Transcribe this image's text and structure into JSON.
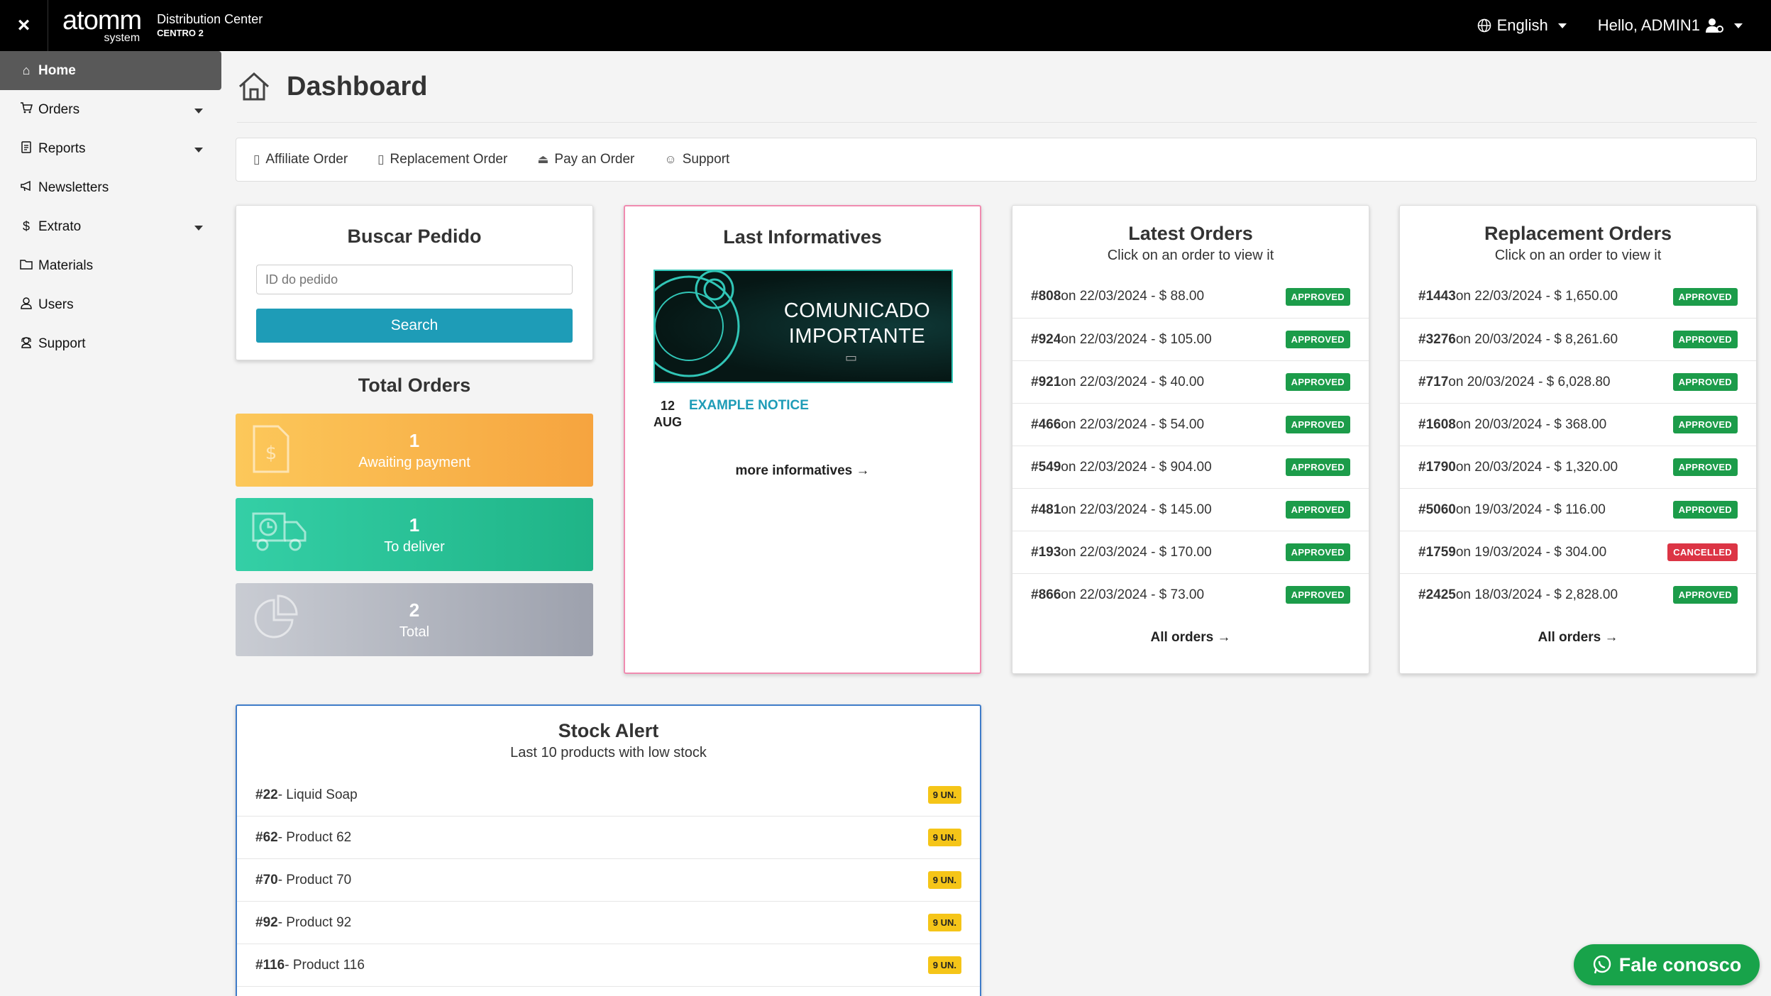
{
  "topbar": {
    "close_label": "×",
    "logo_main": "atomm",
    "logo_sub": "system",
    "center_title": "Distribution Center",
    "center_sub": "CENTRO 2",
    "language": "English",
    "greeting": "Hello, ADMIN1"
  },
  "sidebar": {
    "items": [
      {
        "label": "Home",
        "icon": "home-icon"
      },
      {
        "label": "Orders",
        "icon": "cart-icon"
      },
      {
        "label": "Reports",
        "icon": "report-icon"
      },
      {
        "label": "Newsletters",
        "icon": "megaphone-icon"
      },
      {
        "label": "Extrato",
        "icon": "dollar-icon"
      },
      {
        "label": "Materials",
        "icon": "folder-icon"
      },
      {
        "label": "Users",
        "icon": "user-icon"
      },
      {
        "label": "Support",
        "icon": "support-icon"
      }
    ]
  },
  "page": {
    "title": "Dashboard"
  },
  "quickbar": {
    "items": [
      "Affiliate Order",
      "Replacement Order",
      "Pay an Order",
      "Support"
    ]
  },
  "search": {
    "title": "Buscar Pedido",
    "placeholder": "ID do pedido",
    "button": "Search"
  },
  "totals": {
    "title": "Total Orders",
    "awaiting": {
      "count": "1",
      "label": "Awaiting payment"
    },
    "deliver": {
      "count": "1",
      "label": "To deliver"
    },
    "total": {
      "count": "2",
      "label": "Total"
    }
  },
  "informatives": {
    "title": "Last Informatives",
    "banner_line1": "COMUNICADO",
    "banner_line2": "IMPORTANTE",
    "notice_day": "12",
    "notice_month": "AUG",
    "notice_title": "EXAMPLE NOTICE",
    "more_label": "more informatives →"
  },
  "latest_orders": {
    "title": "Latest Orders",
    "subtitle": "Click on an order to view it",
    "all_label": "All orders →",
    "rows": [
      {
        "id": "#808",
        "text": " on 22/03/2024 - $ 88.00",
        "status": "APPROVED"
      },
      {
        "id": "#924",
        "text": " on 22/03/2024 - $ 105.00",
        "status": "APPROVED"
      },
      {
        "id": "#921",
        "text": " on 22/03/2024 - $ 40.00",
        "status": "APPROVED"
      },
      {
        "id": "#466",
        "text": " on 22/03/2024 - $ 54.00",
        "status": "APPROVED"
      },
      {
        "id": "#549",
        "text": " on 22/03/2024 - $ 904.00",
        "status": "APPROVED"
      },
      {
        "id": "#481",
        "text": " on 22/03/2024 - $ 145.00",
        "status": "APPROVED"
      },
      {
        "id": "#193",
        "text": " on 22/03/2024 - $ 170.00",
        "status": "APPROVED"
      },
      {
        "id": "#866",
        "text": " on 22/03/2024 - $ 73.00",
        "status": "APPROVED"
      }
    ]
  },
  "replacement_orders": {
    "title": "Replacement Orders",
    "subtitle": "Click on an order to view it",
    "all_label": "All orders →",
    "rows": [
      {
        "id": "#1443",
        "text": " on 22/03/2024 - $ 1,650.00",
        "status": "APPROVED"
      },
      {
        "id": "#3276",
        "text": " on 20/03/2024 - $ 8,261.60",
        "status": "APPROVED"
      },
      {
        "id": "#717",
        "text": " on 20/03/2024 - $ 6,028.80",
        "status": "APPROVED"
      },
      {
        "id": "#1608",
        "text": " on 20/03/2024 - $ 368.00",
        "status": "APPROVED"
      },
      {
        "id": "#1790",
        "text": " on 20/03/2024 - $ 1,320.00",
        "status": "APPROVED"
      },
      {
        "id": "#5060",
        "text": " on 19/03/2024 - $ 116.00",
        "status": "APPROVED"
      },
      {
        "id": "#1759",
        "text": " on 19/03/2024 - $ 304.00",
        "status": "CANCELLED"
      },
      {
        "id": "#2425",
        "text": " on 18/03/2024 - $ 2,828.00",
        "status": "APPROVED"
      }
    ]
  },
  "stock": {
    "title": "Stock Alert",
    "subtitle": "Last 10 products with low stock",
    "rows": [
      {
        "id": "#22",
        "name": " - Liquid Soap",
        "qty": "9 UN."
      },
      {
        "id": "#62",
        "name": " - Product 62",
        "qty": "9 UN."
      },
      {
        "id": "#70",
        "name": " - Product 70",
        "qty": "9 UN."
      },
      {
        "id": "#92",
        "name": " - Product 92",
        "qty": "9 UN."
      },
      {
        "id": "#116",
        "name": " - Product 116",
        "qty": "9 UN."
      }
    ]
  },
  "chat": {
    "label": "Fale conosco"
  },
  "colors": {
    "accent": "#1e9cb7",
    "approved": "#1c9c4a",
    "cancelled": "#dc3545",
    "stock_badge": "#f5c518"
  }
}
